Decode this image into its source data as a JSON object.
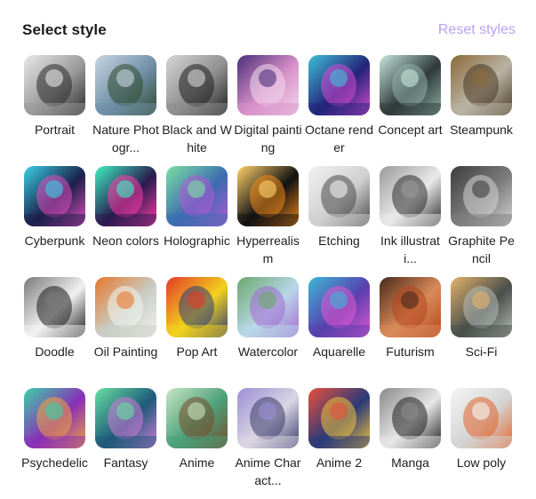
{
  "header": {
    "title": "Select style",
    "reset_label": "Reset styles"
  },
  "styles": [
    {
      "label": "Portrait",
      "name": "portrait",
      "bg": "#9a9a9a",
      "fg": "#2a2a2a",
      "accent": "#e8e8e8"
    },
    {
      "label": "Nature Photogr...",
      "name": "nature-photography",
      "bg": "#6f8fa8",
      "fg": "#2f4a2a",
      "accent": "#c8d6e2"
    },
    {
      "label": "Black and White",
      "name": "black-and-white",
      "bg": "#8e8e8e",
      "fg": "#1f1f1f",
      "accent": "#d6d6d6"
    },
    {
      "label": "Digital painting",
      "name": "digital-painting",
      "bg": "#d991c9",
      "fg": "#f1d9ec",
      "accent": "#4b2f7a"
    },
    {
      "label": "Octane render",
      "name": "octane-render",
      "bg": "#23247a",
      "fg": "#d54bd1",
      "accent": "#3fc0d6"
    },
    {
      "label": "Concept art",
      "name": "concept-art",
      "bg": "#2f3a3a",
      "fg": "#8fb0a6",
      "accent": "#c6e6dc"
    },
    {
      "label": "Steampunk",
      "name": "steampunk",
      "bg": "#b9b3a4",
      "fg": "#4a3a24",
      "accent": "#8a6a3a"
    },
    {
      "label": "Cyberpunk",
      "name": "cyberpunk",
      "bg": "#1c1f4a",
      "fg": "#e04fc0",
      "accent": "#39d1e6"
    },
    {
      "label": "Neon colors",
      "name": "neon-colors",
      "bg": "#2a1a4e",
      "fg": "#ff3da8",
      "accent": "#3ef0c2"
    },
    {
      "label": "Holographic",
      "name": "holographic",
      "bg": "#3c6bb0",
      "fg": "#b35ad6",
      "accent": "#7be0a2"
    },
    {
      "label": "Hyperrealism",
      "name": "hyperrealism",
      "bg": "#111111",
      "fg": "#f08a1c",
      "accent": "#ffd16a"
    },
    {
      "label": "Etching",
      "name": "etching",
      "bg": "#cfcfcf",
      "fg": "#4a4a4a",
      "accent": "#f2f2f2"
    },
    {
      "label": "Ink illustrati...",
      "name": "ink-illustration",
      "bg": "#e9e9e9",
      "fg": "#2b2b2b",
      "accent": "#9a9a9a"
    },
    {
      "label": "Graphite Pencil",
      "name": "graphite-pencil",
      "bg": "#7d7d7d",
      "fg": "#d4d4d4",
      "accent": "#3d3d3d"
    },
    {
      "label": "Doodle",
      "name": "doodle",
      "bg": "#f1f1f1",
      "fg": "#1c1c1c",
      "accent": "#7a7a7a"
    },
    {
      "label": "Oil Painting",
      "name": "oil-painting",
      "bg": "#c9cdc6",
      "fg": "#f2f2ef",
      "accent": "#e6782a"
    },
    {
      "label": "Pop Art",
      "name": "pop-art",
      "bg": "#f2d21c",
      "fg": "#2b3a7a",
      "accent": "#e23a2a"
    },
    {
      "label": "Watercolor",
      "name": "watercolor",
      "bg": "#b8d7e8",
      "fg": "#a36ad1",
      "accent": "#6aa86a"
    },
    {
      "label": "Aquarelle",
      "name": "aquarelle",
      "bg": "#5a3fae",
      "fg": "#e457d2",
      "accent": "#3bb7d6"
    },
    {
      "label": "Futurism",
      "name": "futurism",
      "bg": "#d98a5a",
      "fg": "#b3461c",
      "accent": "#4a2a1a"
    },
    {
      "label": "Sci-Fi",
      "name": "sci-fi",
      "bg": "#4a4f4c",
      "fg": "#b7bcb8",
      "accent": "#e2b26a"
    },
    {
      "label": "Psychedelic",
      "name": "psychedelic",
      "bg": "#8a2fb8",
      "fg": "#f2a53a",
      "accent": "#3ad1a8"
    },
    {
      "label": "Fantasy",
      "name": "fantasy",
      "bg": "#1e5a7a",
      "fg": "#d27bd8",
      "accent": "#66e0a0"
    },
    {
      "label": "Anime",
      "name": "anime",
      "bg": "#4aa07a",
      "fg": "#7a4a2a",
      "accent": "#c7e6c2"
    },
    {
      "label": "Anime Charact...",
      "name": "anime-character",
      "bg": "#d9d6e2",
      "fg": "#3a3a6a",
      "accent": "#9c8fd6"
    },
    {
      "label": "Anime 2",
      "name": "anime-2",
      "bg": "#2a3a7a",
      "fg": "#f2c23a",
      "accent": "#e6503a"
    },
    {
      "label": "Manga",
      "name": "manga",
      "bg": "#e6e6e6",
      "fg": "#1e1e1e",
      "accent": "#8a8a8a"
    },
    {
      "label": "Low poly",
      "name": "low-poly",
      "bg": "#d4d4d4",
      "fg": "#e0652a",
      "accent": "#f5f5f5"
    }
  ]
}
